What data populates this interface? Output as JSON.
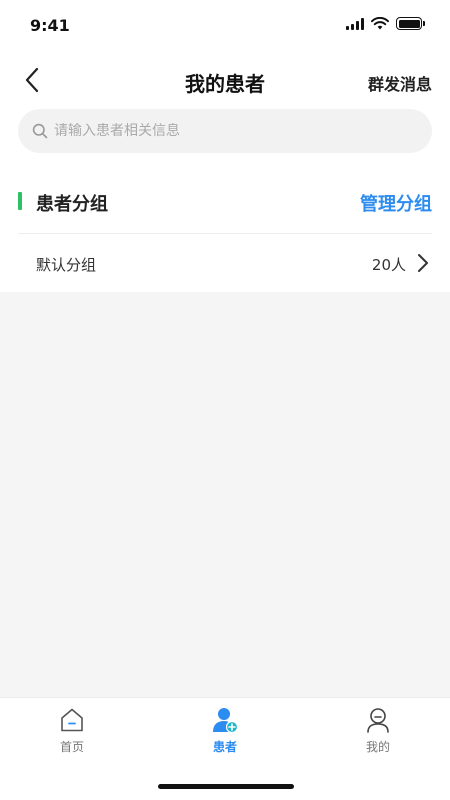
{
  "status_bar": {
    "time": "9:41"
  },
  "nav": {
    "title": "我的患者",
    "broadcast_label": "群发消息"
  },
  "search": {
    "placeholder": "请输入患者相关信息",
    "value": ""
  },
  "section": {
    "title": "患者分组",
    "manage_label": "管理分组"
  },
  "groups": [
    {
      "name": "默认分组",
      "count": "20人"
    }
  ],
  "tabs": [
    {
      "label": "首页",
      "icon": "home-icon",
      "active": false
    },
    {
      "label": "患者",
      "icon": "patient-icon",
      "active": true
    },
    {
      "label": "我的",
      "icon": "profile-icon",
      "active": false
    }
  ],
  "colors": {
    "accent": "#2d8cf0",
    "section_marker": "#2ec163",
    "page_bg": "#f5f5f5"
  }
}
